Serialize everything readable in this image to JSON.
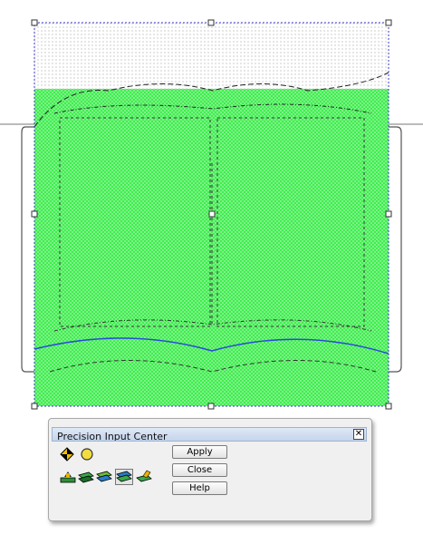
{
  "panel": {
    "title": "Precision Input Center",
    "close_glyph": "✕",
    "buttons": {
      "apply": "Apply",
      "close": "Close",
      "help": "Help"
    },
    "mode_icons": [
      "node-diamond-icon",
      "node-circle-icon"
    ],
    "tool_icons": [
      "layer-tool-1-icon",
      "layer-tool-2-icon",
      "layer-tool-3-icon",
      "layer-tool-4-icon",
      "layer-tool-5-icon"
    ]
  },
  "canvas": {
    "fill_color": "#33ee44",
    "stitch_color": "#a4f0aa",
    "outline_color": "#3a3acc",
    "wave_color": "#2a4bd8"
  }
}
